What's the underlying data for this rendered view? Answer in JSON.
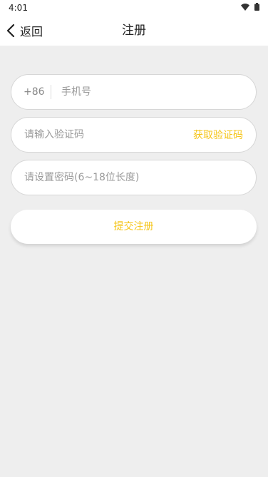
{
  "status_bar": {
    "time": "4:01"
  },
  "nav": {
    "back_label": "返回",
    "title": "注册"
  },
  "form": {
    "country_code": "+86",
    "phone_placeholder": "手机号",
    "code_placeholder": "请输入验证码",
    "get_code_label": "获取验证码",
    "password_placeholder": "请设置密码(6~18位长度)",
    "submit_label": "提交注册"
  },
  "colors": {
    "accent": "#f5c518",
    "background": "#eeeeee"
  }
}
